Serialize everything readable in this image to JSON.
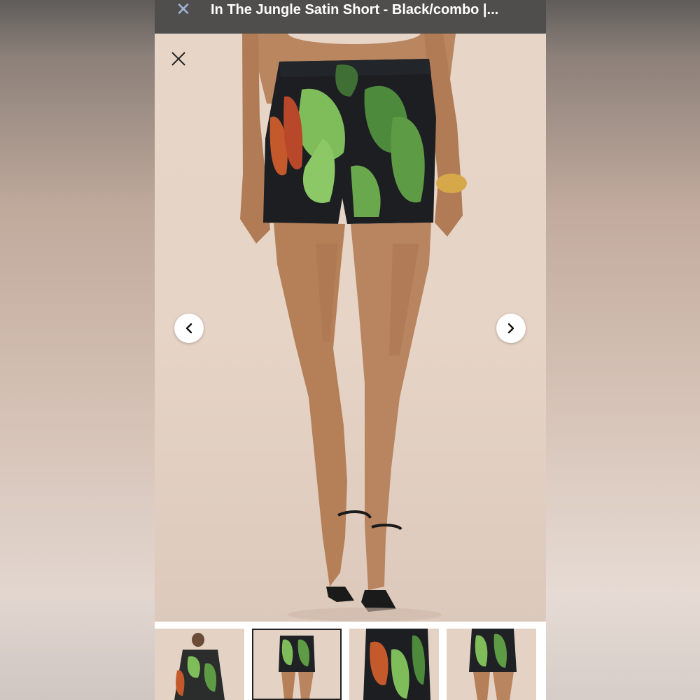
{
  "header": {
    "close_icon": "close-icon",
    "title": "In The Jungle Satin Short - Black/combo |..."
  },
  "viewer": {
    "close_icon": "close-icon",
    "prev_icon": "chevron-left-icon",
    "next_icon": "chevron-right-icon"
  },
  "thumbnails": {
    "count": 4,
    "selected_index": 1
  },
  "colors": {
    "header_bg": "#504e4d",
    "header_close": "#9fb4d6",
    "background": "#e6d4c6"
  }
}
